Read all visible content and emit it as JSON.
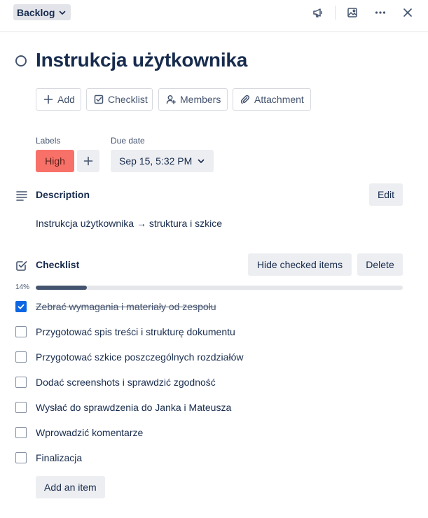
{
  "header": {
    "list_name": "Backlog"
  },
  "card": {
    "title": "Instrukcja użytkownika"
  },
  "actions": {
    "add": "Add",
    "checklist": "Checklist",
    "members": "Members",
    "attachment": "Attachment"
  },
  "labels": {
    "heading": "Labels",
    "items": [
      {
        "text": "High",
        "color": "#f87168"
      }
    ]
  },
  "due_date": {
    "heading": "Due date",
    "value": "Sep 15, 5:32 PM"
  },
  "description": {
    "heading": "Description",
    "edit_label": "Edit",
    "text": "Instrukcja użytkownika → struktura i szkice"
  },
  "checklist": {
    "heading": "Checklist",
    "hide_checked_label": "Hide checked items",
    "delete_label": "Delete",
    "progress_text": "14%",
    "progress_fraction": 0.14,
    "items": [
      {
        "text": "Zebrać wymagania i materiały od zespołu",
        "checked": true
      },
      {
        "text": "Przygotować spis treści i strukturę dokumentu",
        "checked": false
      },
      {
        "text": "Przygotować szkice poszczególnych rozdziałów",
        "checked": false
      },
      {
        "text": "Dodać screenshots  i sprawdzić zgodność",
        "checked": false
      },
      {
        "text": "Wysłać do sprawdzenia do Janka i Mateusza",
        "checked": false
      },
      {
        "text": "Wprowadzić komentarze",
        "checked": false
      },
      {
        "text": "Finalizacja",
        "checked": false
      }
    ],
    "add_item_label": "Add an item"
  },
  "colors": {
    "text": "#172b4d",
    "subtle": "#44546f",
    "check_blue": "#0c66e4",
    "progress": "#44546f",
    "button_grey": "#edeef1"
  },
  "icons": [
    "chevron-down-icon",
    "megaphone-icon",
    "image-icon",
    "more-icon",
    "close-icon",
    "circle-icon",
    "plus-icon",
    "checkbox-icon",
    "add-member-icon",
    "paperclip-icon",
    "description-icon",
    "checklist-icon",
    "check-icon"
  ]
}
